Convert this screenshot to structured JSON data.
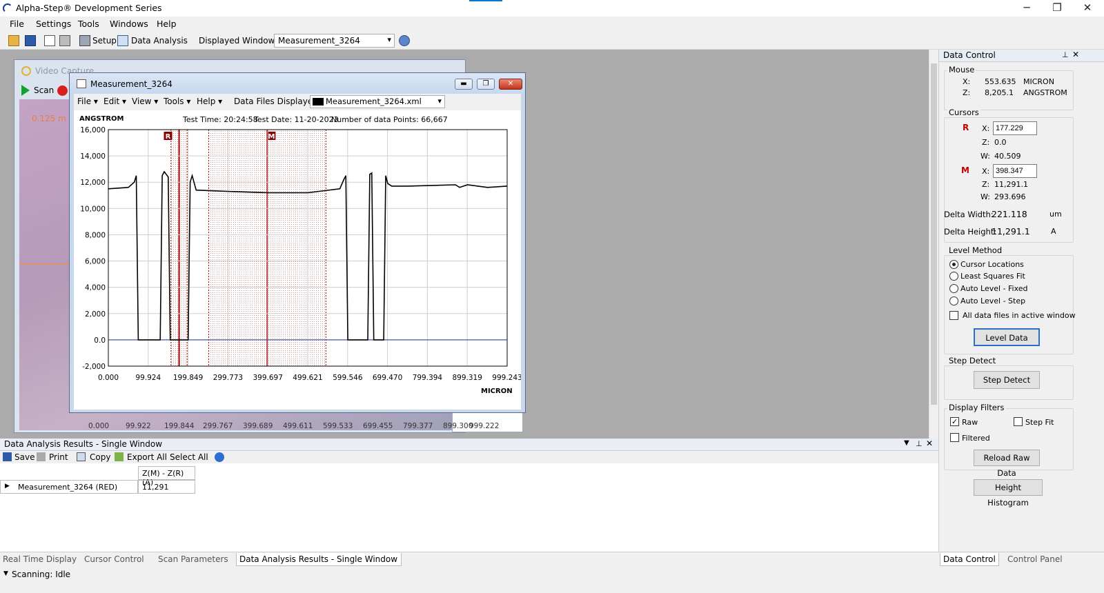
{
  "app": {
    "title": "Alpha-Step® Development Series",
    "controls": {
      "minimize": "─",
      "maximize": "❐",
      "close": "✕"
    }
  },
  "menu": [
    "File",
    "Settings",
    "Tools",
    "Windows",
    "Help"
  ],
  "toolbar": {
    "setup": "Setup",
    "data_analysis": "Data Analysis",
    "displayed_windows_label": "Displayed Windows:",
    "displayed_windows_value": "Measurement_3264",
    "dropdown_arrow": "▾"
  },
  "video_window": {
    "title": "Video Capture",
    "scan_label": "Scan",
    "overlay_value": "0.125 m",
    "x_ticks": [
      "0.000",
      "99.922",
      "199.844",
      "299.767",
      "399.689",
      "499.611",
      "599.533",
      "699.455",
      "799.377",
      "899.300",
      "999.222"
    ]
  },
  "measurement_window": {
    "title": "Measurement_3264",
    "menu": [
      "File ▾",
      "Edit ▾",
      "View ▾",
      "Tools ▾",
      "Help ▾"
    ],
    "data_files_label": "Data Files Displayed:",
    "data_file": "Measurement_3264.xml",
    "y_unit": "ANGSTROM",
    "x_unit": "MICRON",
    "test_time": "Test Time: 20:24:58",
    "test_date": "Test Date: 11-20-2023",
    "num_points": "Number of data Points: 66,667",
    "cursor_r": "R",
    "cursor_m": "M"
  },
  "chart_data": {
    "type": "line",
    "xlabel": "MICRON",
    "ylabel": "ANGSTROM",
    "ylim": [
      -2000,
      16000
    ],
    "xlim": [
      0,
      999.243
    ],
    "y_ticks": [
      "16,000",
      "14,000",
      "12,000",
      "10,000",
      "8,000",
      "6,000",
      "4,000",
      "2,000",
      "0.0",
      "-2,000"
    ],
    "x_ticks": [
      "0.000",
      "99.924",
      "199.849",
      "299.773",
      "399.697",
      "499.621",
      "599.546",
      "699.470",
      "799.394",
      "899.319",
      "999.243"
    ],
    "grid": true,
    "cursors": [
      {
        "name": "R",
        "x": 177.229,
        "width": 40.509
      },
      {
        "name": "M",
        "x": 398.347,
        "width": 293.696
      }
    ],
    "series": [
      {
        "x": [
          0,
          50,
          65,
          70,
          75,
          130,
          135,
          140,
          150,
          155,
          160,
          173,
          185,
          200,
          205,
          210,
          220,
          300,
          400,
          500,
          580,
          590,
          595,
          600,
          625,
          630,
          650,
          655,
          660,
          665,
          673,
          690,
          695,
          700,
          710,
          750,
          870,
          880,
          900,
          950,
          999
        ],
        "y": [
          11500,
          11600,
          12000,
          12500,
          0,
          0,
          12500,
          12800,
          12400,
          0,
          0,
          0,
          0,
          0,
          12000,
          12500,
          11400,
          11300,
          11200,
          11200,
          11500,
          12200,
          12500,
          0,
          0,
          0,
          0,
          12600,
          12700,
          0,
          0,
          0,
          12500,
          11900,
          11700,
          11700,
          11800,
          11600,
          11800,
          11600,
          11700
        ]
      }
    ]
  },
  "data_control": {
    "title": "Data Control",
    "mouse_label": "Mouse",
    "mouse_x_label": "X:",
    "mouse_x": "553.635",
    "mouse_x_unit": "MICRON",
    "mouse_z_label": "Z:",
    "mouse_z": "8,205.1",
    "mouse_z_unit": "ANGSTROM",
    "cursors_label": "Cursors",
    "r_label": "R",
    "m_label": "M",
    "r_x": "177.229",
    "r_z": "0.0",
    "r_w": "40.509",
    "m_x": "398.347",
    "m_z": "11,291.1",
    "m_w": "293.696",
    "x_lbl": "X:",
    "z_lbl": "Z:",
    "w_lbl": "W:",
    "delta_width_label": "Delta Width:",
    "delta_width": "221.118",
    "delta_width_unit": "um",
    "delta_height_label": "Delta Height:",
    "delta_height": "11,291.1",
    "delta_height_unit": "A",
    "level_method_label": "Level Method",
    "level_options": [
      "Cursor Locations",
      "Least Squares Fit",
      "Auto Level - Fixed",
      "Auto Level - Step"
    ],
    "all_files_label": "All data files in active window",
    "level_data_button": "Level Data",
    "step_detect_label": "Step Detect",
    "step_detect_button": "Step Detect",
    "display_filters_label": "Display Filters",
    "raw_label": "Raw",
    "step_fit_label": "Step Fit",
    "filtered_label": "Filtered",
    "reload_button": "Reload Raw Data",
    "histogram_button": "Height Histogram"
  },
  "results": {
    "title": "Data Analysis Results - Single Window",
    "toolbar": [
      "Save",
      "Print",
      "Copy",
      "Export All",
      "Select All"
    ],
    "column_header": "Z(M) - Z(R) (A)",
    "row_label": "Measurement_3264 (RED)",
    "row_value": "11,291"
  },
  "bottom_tabs": [
    "Real Time Display",
    "Cursor Control",
    "Scan Parameters",
    "Data Analysis Results - Single Window"
  ],
  "right_tabs": [
    "Data Control",
    "Control Panel"
  ],
  "status": "Scanning: Idle",
  "colors": {
    "accent": "#0078d7",
    "cursor_red": "#b00000",
    "trace": "#000000",
    "zero_line": "#1e2f9e"
  }
}
